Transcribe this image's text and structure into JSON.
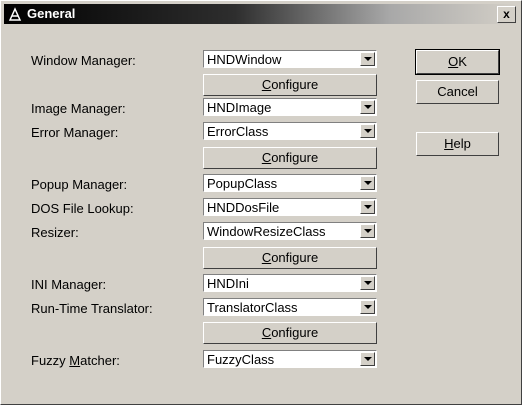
{
  "window": {
    "title": "General",
    "close_glyph": "x"
  },
  "rows": [
    {
      "label": "Window Manager:",
      "value": "HNDWindow"
    },
    {
      "label": "Image Manager:",
      "value": "HNDImage"
    },
    {
      "label": "Error Manager:",
      "value": "ErrorClass"
    },
    {
      "label": "Popup Manager:",
      "value": "PopupClass"
    },
    {
      "label": "DOS File Lookup:",
      "value": "HNDDosFile"
    },
    {
      "label": "Resizer:",
      "value": "WindowResizeClass"
    },
    {
      "label": "INI Manager:",
      "value": "HNDIni"
    },
    {
      "label": "Run-Time Translator:",
      "value": "TranslatorClass"
    },
    {
      "label": "Fuzzy Matcher:",
      "value": "FuzzyClass"
    }
  ],
  "configure": {
    "mnemonic": "C",
    "rest": "onfigure"
  },
  "fuzzy_label": {
    "pre": "Fuzzy ",
    "mnemonic": "M",
    "rest": "atcher:"
  },
  "ok": {
    "mnemonic": "O",
    "rest": "K"
  },
  "cancel": {
    "label": "Cancel"
  },
  "help": {
    "mnemonic": "H",
    "rest": "elp"
  }
}
